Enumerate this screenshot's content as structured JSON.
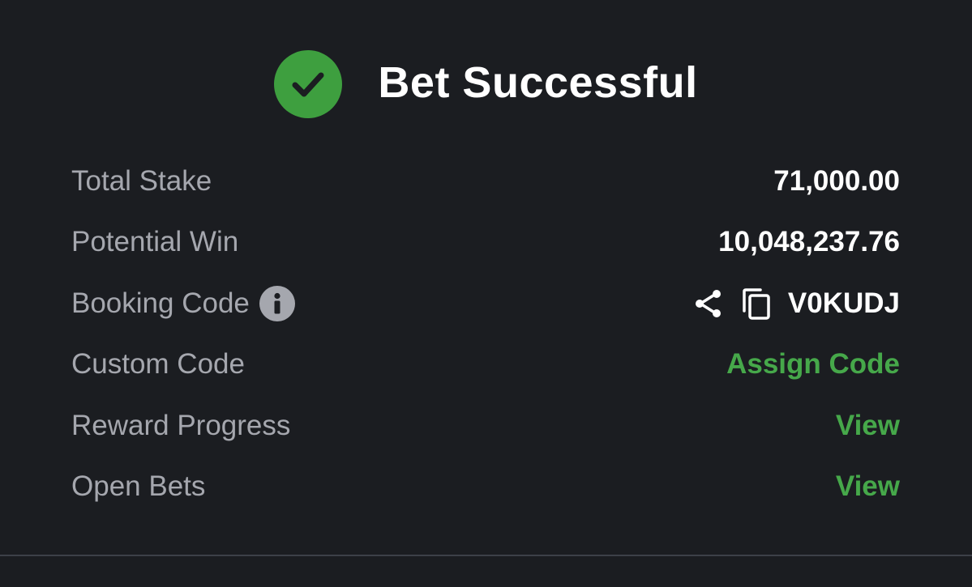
{
  "header": {
    "title": "Bet Successful",
    "icon": "check-circle-icon",
    "accent": "#3e9f3f"
  },
  "rows": [
    {
      "label": "Total Stake",
      "value": "71,000.00"
    },
    {
      "label": "Potential Win",
      "value": "10,048,237.76"
    },
    {
      "label": "Booking Code",
      "value": "V0KUDJ",
      "label_icon": "info-icon",
      "actions": [
        "share-icon",
        "copy-icon"
      ]
    },
    {
      "label": "Custom Code",
      "value": "Assign Code"
    },
    {
      "label": "Reward Progress",
      "value": "View"
    },
    {
      "label": "Open Bets",
      "value": "View"
    }
  ],
  "colors": {
    "background": "#1b1d21",
    "label": "#a5a7ae",
    "value": "#ffffff",
    "link": "#46a84a"
  }
}
